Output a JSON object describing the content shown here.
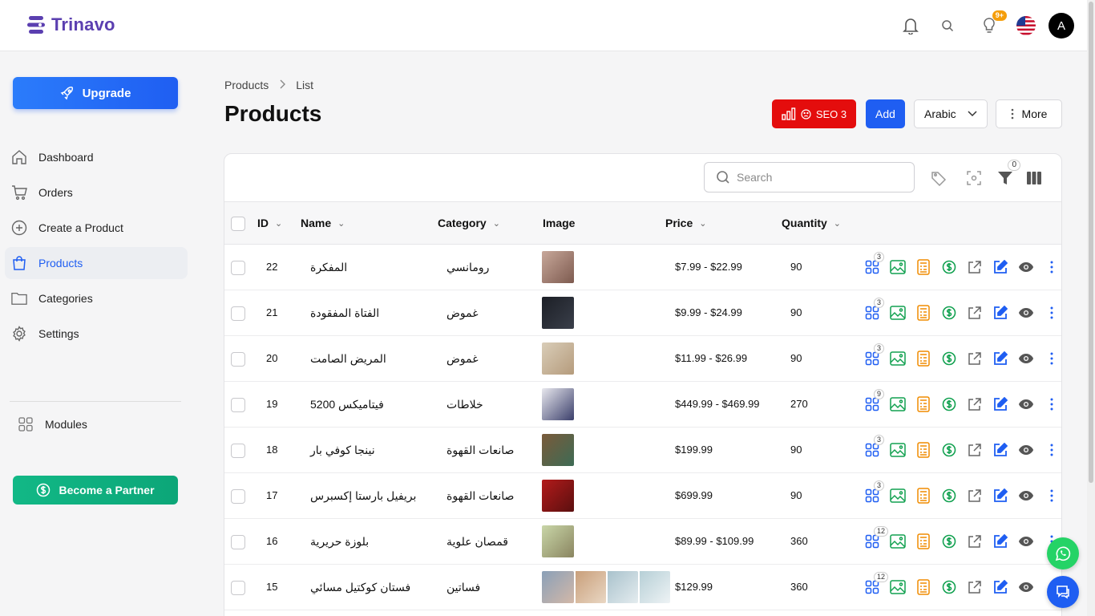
{
  "app": {
    "name": "Trinavo"
  },
  "header": {
    "notifications_badge": "9+",
    "avatar_initial": "A"
  },
  "sidebar": {
    "upgrade_label": "Upgrade",
    "items": [
      {
        "label": "Dashboard",
        "icon": "home-icon"
      },
      {
        "label": "Orders",
        "icon": "cart-icon"
      },
      {
        "label": "Create a Product",
        "icon": "plus-circle-icon"
      },
      {
        "label": "Products",
        "icon": "bag-icon",
        "active": true
      },
      {
        "label": "Categories",
        "icon": "folder-icon"
      },
      {
        "label": "Settings",
        "icon": "gear-icon"
      }
    ],
    "modules_label": "Modules",
    "partner_label": "Become a Partner"
  },
  "breadcrumb": {
    "root": "Products",
    "current": "List"
  },
  "page": {
    "title": "Products"
  },
  "toolbar": {
    "seo_label": "SEO 3",
    "add_label": "Add",
    "language": "Arabic",
    "more_label": "More"
  },
  "table_tools": {
    "search_placeholder": "Search",
    "filter_count": "0"
  },
  "columns": {
    "id": "ID",
    "name": "Name",
    "category": "Category",
    "image": "Image",
    "price": "Price",
    "quantity": "Quantity"
  },
  "rows": [
    {
      "id": "22",
      "name": "المفكرة",
      "category": "رومانسي",
      "price": "$7.99 - $22.99",
      "quantity": "90",
      "variants": "3"
    },
    {
      "id": "21",
      "name": "الفتاة المفقودة",
      "category": "غموض",
      "price": "$9.99 - $24.99",
      "quantity": "90",
      "variants": "3"
    },
    {
      "id": "20",
      "name": "المريض الصامت",
      "category": "غموض",
      "price": "$11.99 - $26.99",
      "quantity": "90",
      "variants": "3"
    },
    {
      "id": "19",
      "name": "فيتاميكس 5200",
      "category": "خلاطات",
      "price": "$449.99 - $469.99",
      "quantity": "270",
      "variants": "9"
    },
    {
      "id": "18",
      "name": "نينجا كوفي بار",
      "category": "صانعات القهوة",
      "price": "$199.99",
      "quantity": "90",
      "variants": "3"
    },
    {
      "id": "17",
      "name": "بريفيل بارستا إكسبرس",
      "category": "صانعات القهوة",
      "price": "$699.99",
      "quantity": "90",
      "variants": "3"
    },
    {
      "id": "16",
      "name": "بلوزة حريرية",
      "category": "قمصان علوية",
      "price": "$89.99 - $109.99",
      "quantity": "360",
      "variants": "12"
    },
    {
      "id": "15",
      "name": "فستان كوكتيل مسائي",
      "category": "فساتين",
      "price": "$129.99",
      "quantity": "360",
      "variants": "12"
    }
  ],
  "colors": {
    "primary": "#1f5ef2",
    "seo": "#e40d0d",
    "partner": "#12b886",
    "whatsapp": "#25d366",
    "brand": "#5b3fb0"
  }
}
